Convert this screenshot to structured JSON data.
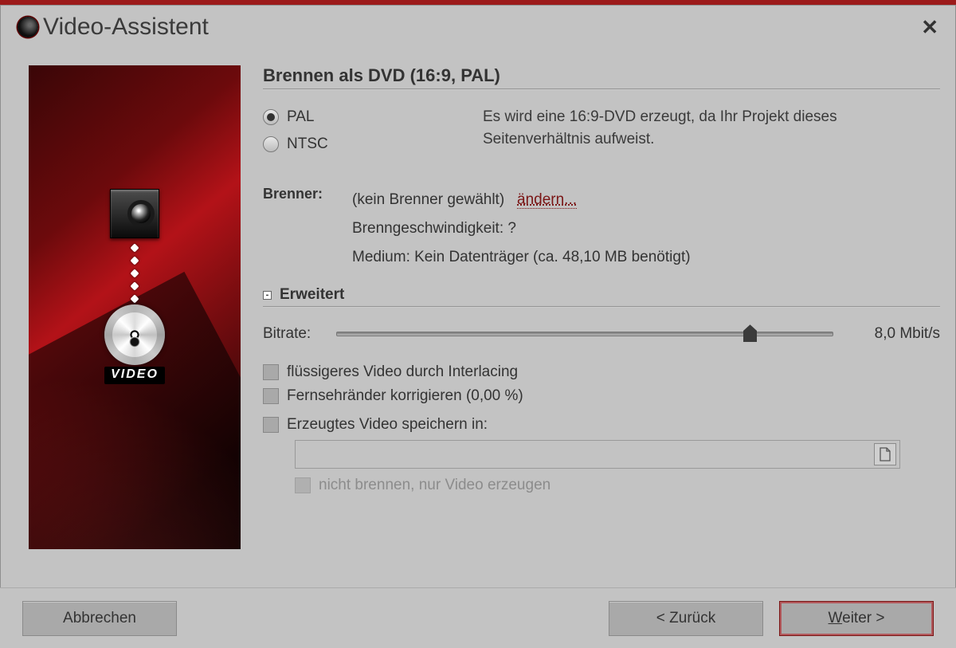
{
  "window": {
    "title": "Video-Assistent"
  },
  "section": {
    "title": "Brennen als DVD (16:9, PAL)"
  },
  "format": {
    "pal": "PAL",
    "ntsc": "NTSC",
    "selected": "PAL",
    "info": "Es wird eine 16:9-DVD erzeugt, da Ihr Projekt dieses Seitenverhältnis aufweist."
  },
  "burner": {
    "label": "Brenner:",
    "none": "(kein Brenner gewählt)",
    "change": "ändern...",
    "speed": "Brenngeschwindigkeit: ?",
    "medium": "Medium: Kein Datenträger (ca. 48,10 MB benötigt)"
  },
  "advanced": {
    "title": "Erweitert",
    "bitrate_label": "Bitrate:",
    "bitrate_value": "8,0 Mbit/s",
    "opt_interlacing": "flüssigeres Video durch Interlacing",
    "opt_tv_edges": "Fernsehränder korrigieren (0,00 %)",
    "opt_save_in": "Erzeugtes Video speichern in:",
    "opt_no_burn": "nicht brennen, nur Video erzeugen",
    "save_path": ""
  },
  "side": {
    "video_label": "VIDEO"
  },
  "buttons": {
    "cancel": "Abbrechen",
    "back": "< Zurück",
    "next_prefix": "W",
    "next_rest": "eiter >"
  }
}
